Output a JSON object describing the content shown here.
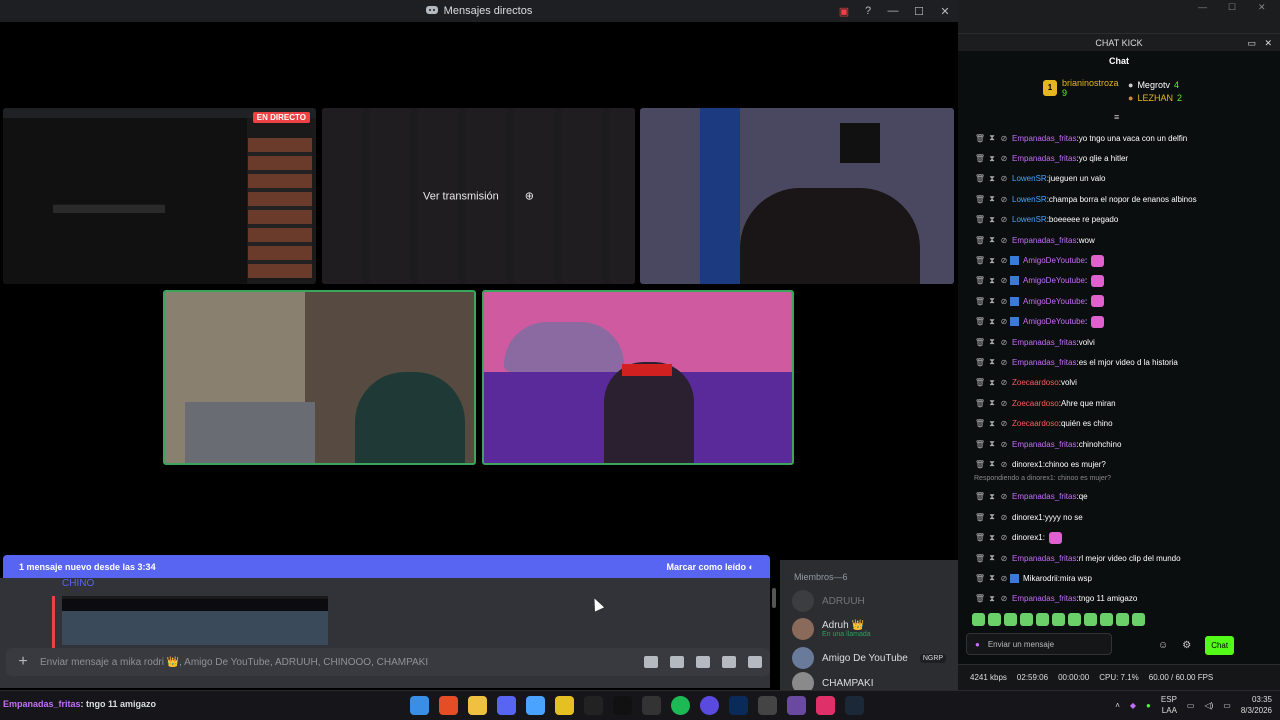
{
  "discord": {
    "window_title": "Mensajes directos",
    "live_badge": "EN DIRECTO",
    "watch_stream": "Ver transmisión",
    "new_messages_banner": "1 mensaje nuevo desde las 3:34",
    "mark_read": "Marcar como leído",
    "chat_author": "CHINO",
    "composer_placeholder": "Enviar mensaje a mika rodri 👑, Amigo De YouTube, ADRUUH, CHINOOO, CHAMPAKI",
    "members_header": "Miembros—6",
    "members": [
      {
        "name": "ADRUUH",
        "status": "",
        "tag": ""
      },
      {
        "name": "Adruh 👑",
        "status": "En una llamada",
        "tag": ""
      },
      {
        "name": "Amigo De YouTube",
        "status": "",
        "tag": "NGRP"
      },
      {
        "name": "CHAMPAKI",
        "status": "",
        "tag": ""
      }
    ]
  },
  "kick": {
    "header": "CHAT KICK",
    "chat_title": "Chat",
    "podium": {
      "first_name": "brianinostroza",
      "first_count": "9",
      "second_name": "Megrotv",
      "second_count": "4",
      "third_name": "LEZHAN",
      "third_count": "2"
    },
    "messages": [
      {
        "user": "Empanadas_fritas",
        "text": "yo tngo una vaca con un delfin",
        "color": "#c46ef8"
      },
      {
        "user": "Empanadas_fritas",
        "text": "yo qlie a hitler",
        "color": "#c46ef8"
      },
      {
        "user": "LowenSR",
        "text": "jueguen un valo",
        "color": "#4aa3ff"
      },
      {
        "user": "LowenSR",
        "text": "champa borra el nopor de enanos albinos",
        "color": "#4aa3ff"
      },
      {
        "user": "LowenSR",
        "text": "boeeeee re pegado",
        "color": "#4aa3ff"
      },
      {
        "user": "Empanadas_fritas",
        "text": "wow",
        "color": "#c46ef8"
      },
      {
        "user": "AmigoDeYoutube",
        "text": "",
        "color": "#c46ef8"
      },
      {
        "user": "AmigoDeYoutube",
        "text": "",
        "color": "#c46ef8"
      },
      {
        "user": "AmigoDeYoutube",
        "text": "",
        "color": "#c46ef8"
      },
      {
        "user": "AmigoDeYoutube",
        "text": "",
        "color": "#c46ef8"
      },
      {
        "user": "Empanadas_fritas",
        "text": "volvi",
        "color": "#c46ef8"
      },
      {
        "user": "Empanadas_fritas",
        "text": "es el mjor video d la historia",
        "color": "#c46ef8"
      },
      {
        "user": "Zoecaardoso",
        "text": "volvi",
        "color": "#ff5a5a"
      },
      {
        "user": "Zoecaardoso",
        "text": "Ahre que miran",
        "color": "#ff5a5a"
      },
      {
        "user": "Zoecaardoso",
        "text": "quién es chino",
        "color": "#ff5a5a"
      },
      {
        "user": "Empanadas_fritas",
        "text": "chinohchino",
        "color": "#c46ef8"
      },
      {
        "user": "dinorex1",
        "text": "chinoo es mujer?",
        "color": "#ffffff"
      }
    ],
    "reply_note": "Respondiendo a dinorex1: chinoo es mujer?",
    "messages2": [
      {
        "user": "Empanadas_fritas",
        "text": "qe",
        "color": "#c46ef8"
      },
      {
        "user": "dinorex1",
        "text": "yyyy no se",
        "color": "#ffffff"
      },
      {
        "user": "dinorex1",
        "text": "",
        "color": "#ffffff"
      },
      {
        "user": "Empanadas_fritas",
        "text": "rl mejor video clip del mundo",
        "color": "#c46ef8"
      },
      {
        "user": "Mikarodrii",
        "text": "mira wsp",
        "color": "#ffffff"
      },
      {
        "user": "Empanadas_fritas",
        "text": "tngo 11 amigazo",
        "color": "#c46ef8"
      }
    ],
    "input_placeholder": "Enviar un mensaje",
    "send_label": "Chat",
    "stats": {
      "bitrate": "4241 kbps",
      "stream_time": "02:59:06",
      "rec_time": "00:00:00",
      "cpu": "CPU: 7.1%",
      "fps": "60.00 / 60.00 FPS"
    }
  },
  "taskbar": {
    "notification_user": "Empanadas_fritas",
    "notification_text": ": tngo 11 amigazo",
    "lang_top": "ESP",
    "lang_bottom": "LAA",
    "time": "03:35",
    "date": "8/3/2026"
  }
}
